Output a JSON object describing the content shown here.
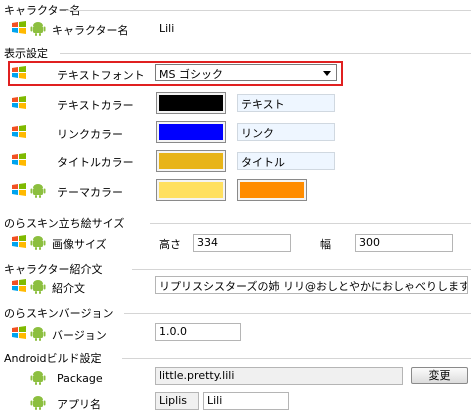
{
  "groups": {
    "character_name": "キャラクター名",
    "display": "表示設定",
    "standing_image": "のらスキン立ち絵サイズ",
    "intro": "キャラクター紹介文",
    "version": "のらスキンバージョン",
    "android": "Androidビルド設定"
  },
  "character_name": {
    "label": "キャラクター名",
    "value": "Lili"
  },
  "text_font": {
    "label": "テキストフォント",
    "value": "MS ゴシック"
  },
  "text_color": {
    "label": "テキストカラー",
    "color": "#000000",
    "preview": "テキスト"
  },
  "link_color": {
    "label": "リンクカラー",
    "color": "#0000ff",
    "preview": "リンク"
  },
  "title_color": {
    "label": "タイトルカラー",
    "color": "#e8b418",
    "preview": "タイトル"
  },
  "theme_color": {
    "label": "テーマカラー",
    "color1": "#ffe060",
    "color2": "#ff8c00"
  },
  "image_size": {
    "label": "画像サイズ",
    "height_label": "高さ",
    "height": "334",
    "width_label": "幅",
    "width": "300"
  },
  "intro": {
    "label": "紹介文",
    "value": "リプリスシスターズの姉 リリ@おしとやかにおしゃべりします。"
  },
  "version": {
    "label": "バージョン",
    "value": "1.0.0"
  },
  "package": {
    "label": "Package",
    "value": "little.pretty.lili",
    "button": "変更"
  },
  "app_name": {
    "label": "アプリ名",
    "value1": "Liplis",
    "value2": "Lili"
  },
  "icons": [
    "windows-flag-icon",
    "android-robot-icon"
  ],
  "highlight_color": "#e02020"
}
